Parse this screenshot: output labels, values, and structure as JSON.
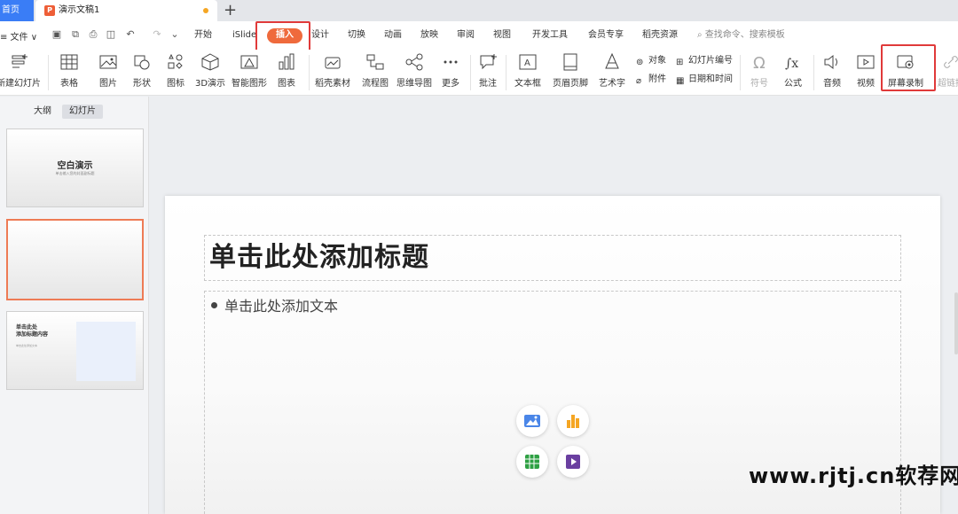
{
  "tabbar": {
    "home_label": "首页",
    "doc_title": "演示文稿1",
    "add_label": "+"
  },
  "menu": {
    "file_label": "≡ 文件 ∨",
    "tabs": [
      "开始",
      "iSlide",
      "插入",
      "设计",
      "切换",
      "动画",
      "放映",
      "审阅",
      "视图",
      "开发工具",
      "会员专享",
      "稻壳资源"
    ],
    "active_tab": "插入",
    "search_placeholder": "查找命令、搜索模板"
  },
  "ribbon": {
    "new_slide": "新建幻灯片",
    "table": "表格",
    "image": "图片",
    "shape": "形状",
    "icon": "图标",
    "d3": "3D演示",
    "smart": "智能图形",
    "chart": "图表",
    "docer": "稻壳素材",
    "flow": "流程图",
    "mind": "思维导图",
    "more": "更多",
    "comment": "批注",
    "textbox": "文本框",
    "header_footer": "页眉页脚",
    "wordart": "艺术字",
    "object": "对象",
    "attachment": "附件",
    "slide_number": "幻灯片编号",
    "date_time": "日期和时间",
    "symbol": "符号",
    "formula": "公式",
    "audio": "音频",
    "video": "视频",
    "screen_record": "屏幕录制",
    "hyperlink": "超链接"
  },
  "panel": {
    "outline_tab": "大纲",
    "slides_tab": "幻灯片",
    "thumbs": [
      {
        "title": "空白演示",
        "subtitle": "单击输入您的封面副标题"
      },
      {
        "title": "",
        "subtitle": ""
      },
      {
        "title": "单击此处\n添加标题内容",
        "subtitle": "单击此处添加文本"
      }
    ]
  },
  "slide": {
    "title_placeholder": "单击此处添加标题",
    "body_placeholder": "单击此处添加文本"
  },
  "watermark": "www.rjtj.cn软荐网",
  "colors": {
    "accent": "#ef6a3c",
    "highlight_box": "#e03a3a",
    "home_tab": "#3a7df6"
  }
}
